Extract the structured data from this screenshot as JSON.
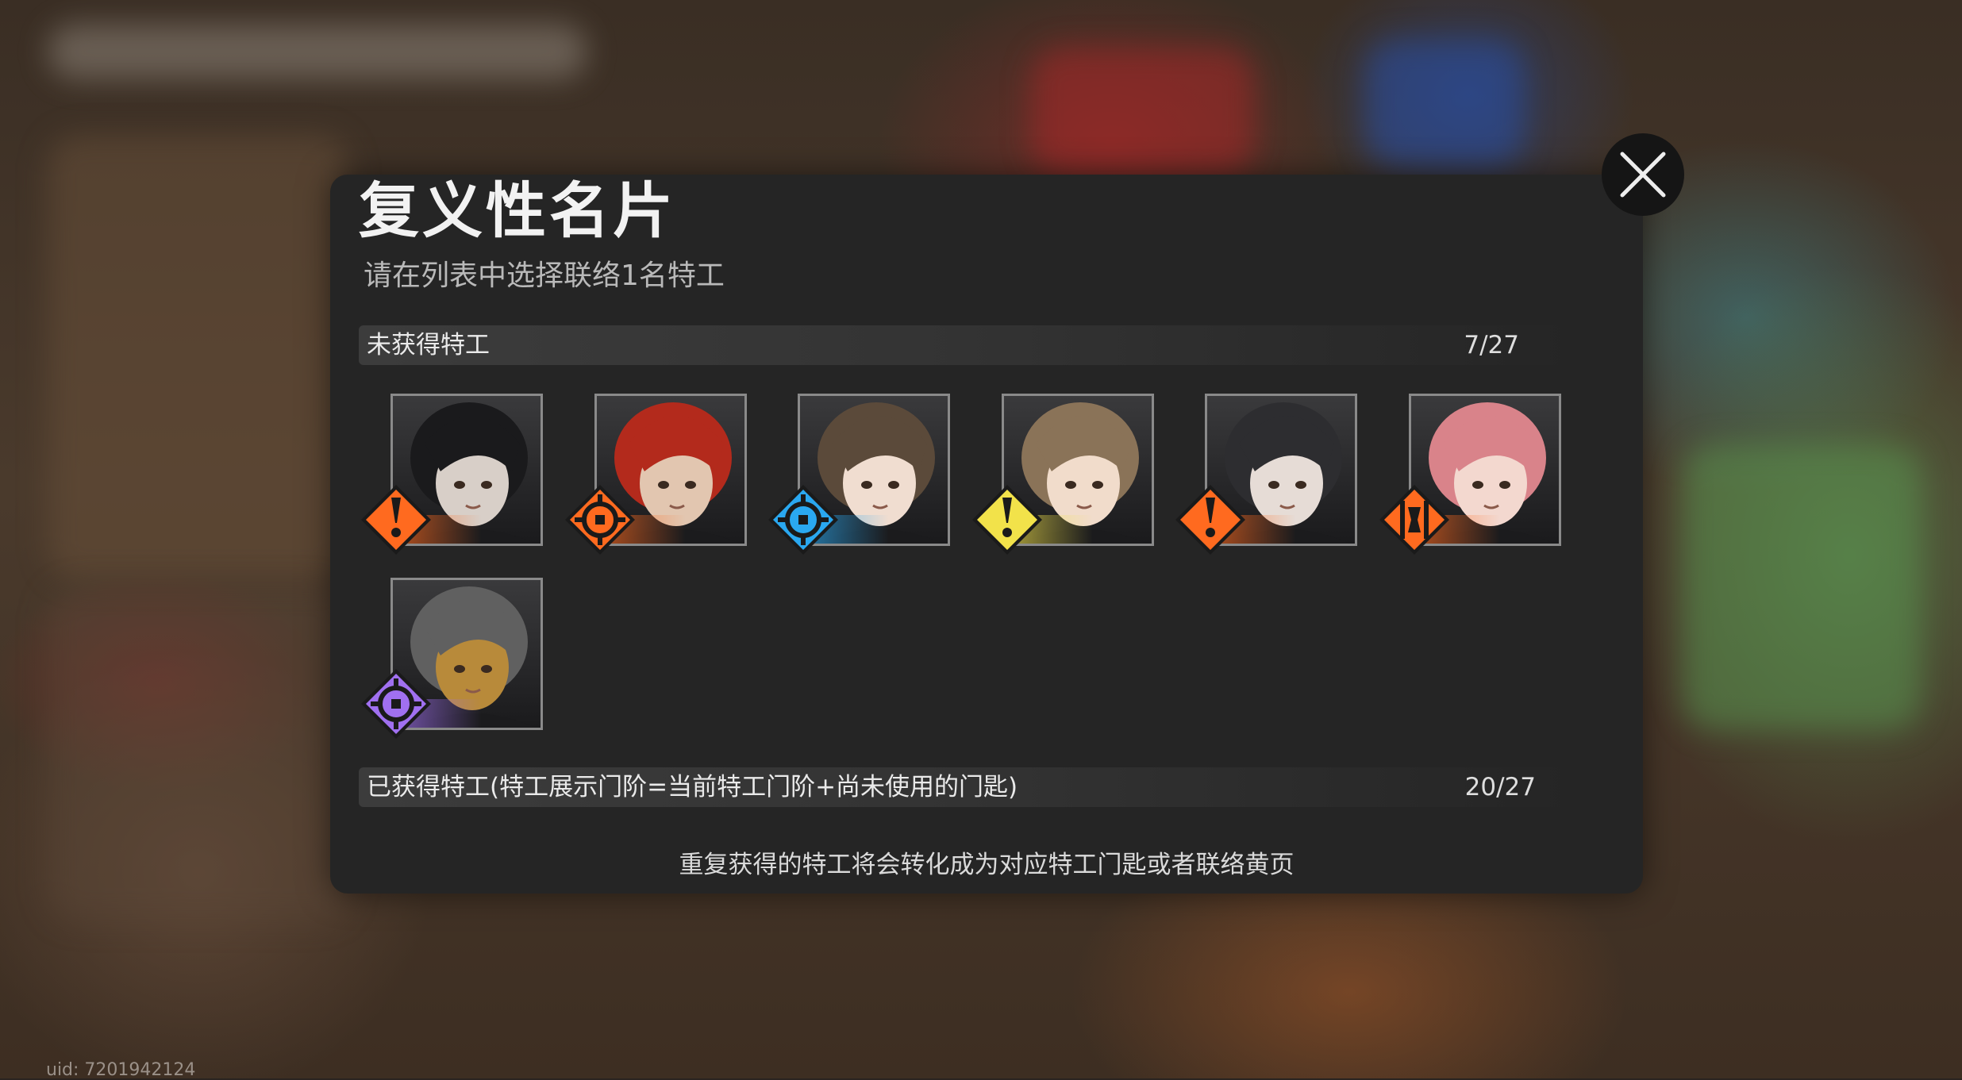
{
  "background": {
    "uid_text": "uid: 7201942124"
  },
  "modal": {
    "title": "复义性名片",
    "subtitle": "请在列表中选择联络1名特工",
    "unobtained": {
      "label": "未获得特工",
      "count": "7/27"
    },
    "obtained": {
      "label": "已获得特工(特工展示门阶=当前特工门阶+尚未使用的门匙)",
      "count": "20/27"
    },
    "footer_note": "重复获得的特工将会转化成为对应特工门匙或者联络黄页"
  },
  "agents": [
    {
      "name": "agent-1",
      "hair": "#1a1a1c",
      "skin": "#d8cfc8",
      "badge_color": "#ff6a1f",
      "badge_icon": "exclamation-icon"
    },
    {
      "name": "agent-2",
      "hair": "#b32a1c",
      "skin": "#e2c6b0",
      "badge_color": "#ff6a1f",
      "badge_icon": "crosshair-icon"
    },
    {
      "name": "agent-3",
      "hair": "#5b4a3a",
      "skin": "#f0ddd0",
      "badge_color": "#2aa8f0",
      "badge_icon": "crosshair-icon"
    },
    {
      "name": "agent-4",
      "hair": "#8a7358",
      "skin": "#f1dccb",
      "badge_color": "#f2e24a",
      "badge_icon": "exclamation-icon"
    },
    {
      "name": "agent-5",
      "hair": "#2d2d30",
      "skin": "#e6dcd6",
      "badge_color": "#ff6a1f",
      "badge_icon": "exclamation-icon"
    },
    {
      "name": "agent-6",
      "hair": "#d9838a",
      "skin": "#f3d8cf",
      "badge_color": "#ff6a1f",
      "badge_icon": "bracket-icon"
    },
    {
      "name": "agent-7",
      "hair": "#606060",
      "skin": "#b88a3a",
      "badge_color": "#a070f0",
      "badge_icon": "crosshair-icon"
    }
  ]
}
